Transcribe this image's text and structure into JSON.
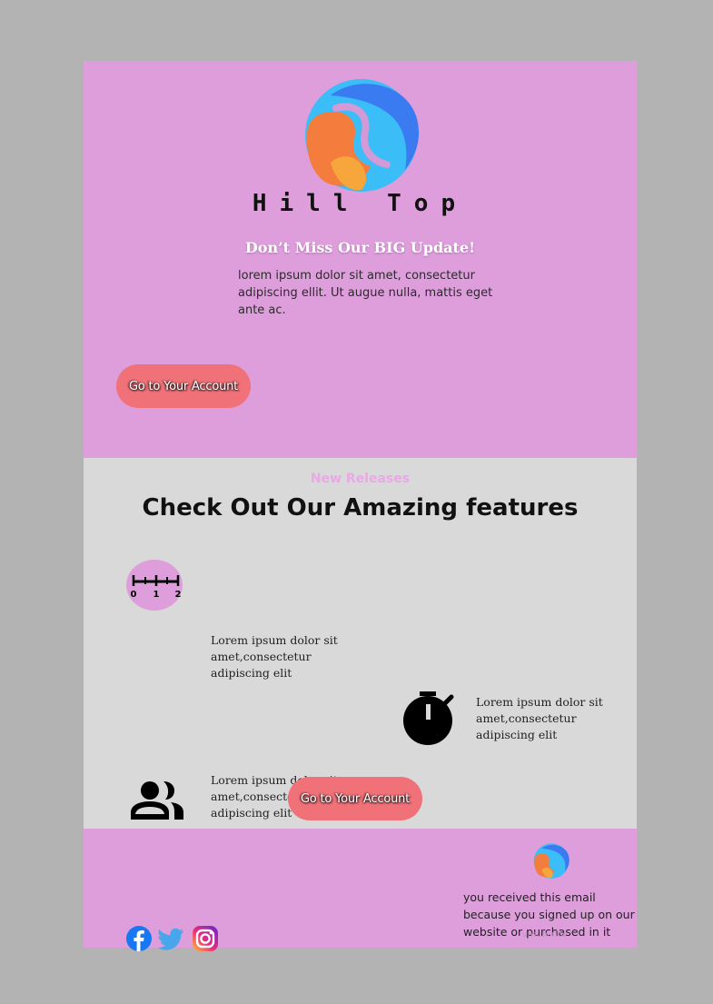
{
  "brand": {
    "name": "Hill Top",
    "logo_icon": "hill-top-logo"
  },
  "header": {
    "headline": "Don’t Miss Our BIG Update!",
    "intro": "lorem ipsum dolor sit amet, consectetur adipiscing ellit. Ut augue nulla, mattis eget ante ac.",
    "cta_label": "Go to Your Account"
  },
  "features": {
    "kicker": "New Releases",
    "title": "Check Out Our Amazing features",
    "items": [
      {
        "icon": "ruler-icon",
        "text": "Lorem ipsum dolor sit amet,consectetur adipiscing elit"
      },
      {
        "icon": "stopwatch-icon",
        "text": "Lorem ipsum dolor sit amet,consectetur adipiscing elit"
      },
      {
        "icon": "people-icon",
        "text": "Lorem ipsum dolor sit amet,consectetur adipiscing elit"
      }
    ],
    "ruler_labels": [
      "0",
      "1",
      "2"
    ],
    "cta_label": "Go to Your Account"
  },
  "footer": {
    "social": [
      "facebook-icon",
      "twitter-icon",
      "instagram-icon"
    ],
    "notice": "you received this email because you signed up on our website or purchased in it",
    "unsubscribe": "unsubcribe"
  },
  "colors": {
    "page_bg": "#b3b3b3",
    "pink": "#dd9edb",
    "gray": "#d9d9d9",
    "cta": "#f07178"
  }
}
